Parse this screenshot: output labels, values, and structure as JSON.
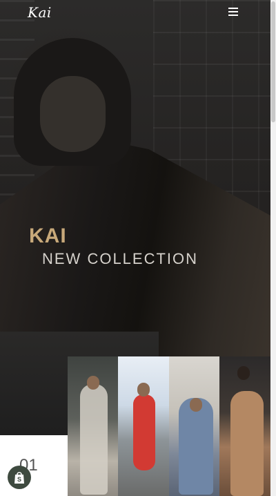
{
  "header": {
    "logo": "Kai",
    "menu_icon": "hamburger-icon"
  },
  "hero": {
    "brand": "KAI",
    "subtitle": "NEW COLLECTION"
  },
  "slider": {
    "counter": "01"
  },
  "colors": {
    "brand_gold": "#c8a97a",
    "badge": "#3e4a3f"
  },
  "icons": {
    "shop_badge": "shopify-bag-icon"
  }
}
